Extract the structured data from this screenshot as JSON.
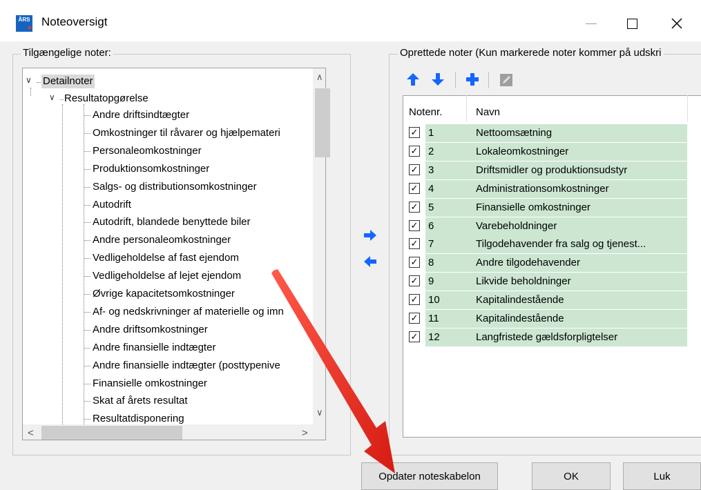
{
  "window": {
    "title": "Noteoversigt",
    "app_icon_text": "ÅRS"
  },
  "left_group": {
    "label": "Tilgængelige noter:",
    "root": "Detailnoter",
    "section": "Resultatopgørelse",
    "items": [
      "Andre driftsindtægter",
      "Omkostninger til råvarer og hjælpemateri",
      "Personaleomkostninger",
      "Produktionsomkostninger",
      "Salgs- og distributionsomkostninger",
      "Autodrift",
      "Autodrift, blandede benyttede biler",
      "Andre personaleomkostninger",
      "Vedligeholdelse af fast ejendom",
      "Vedligeholdelse af lejet ejendom",
      "Øvrige kapacitetsomkostninger",
      "Af- og nedskrivninger af materielle og imn",
      "Andre driftsomkostninger",
      "Andre finansielle indtægter",
      "Andre finansielle indtægter (posttypenive",
      "Finansielle omkostninger",
      "Skat af årets resultat",
      "Resultatdisponering"
    ]
  },
  "right_group": {
    "label": "Oprettede noter (Kun markerede noter kommer på udskri",
    "columns": {
      "num": "Notenr.",
      "name": "Navn"
    },
    "rows": [
      {
        "num": "1",
        "name": "Nettoomsætning",
        "checked": true
      },
      {
        "num": "2",
        "name": "Lokaleomkostninger",
        "checked": true
      },
      {
        "num": "3",
        "name": "Driftsmidler og produktionsudstyr",
        "checked": true
      },
      {
        "num": "4",
        "name": "Administrationsomkostninger",
        "checked": true
      },
      {
        "num": "5",
        "name": "Finansielle omkostninger",
        "checked": true
      },
      {
        "num": "6",
        "name": "Varebeholdninger",
        "checked": true
      },
      {
        "num": "7",
        "name": "Tilgodehavender fra salg og tjenest...",
        "checked": true
      },
      {
        "num": "8",
        "name": "Andre tilgodehavender",
        "checked": true
      },
      {
        "num": "9",
        "name": "Likvide beholdninger",
        "checked": true
      },
      {
        "num": "10",
        "name": "Kapitalindestående",
        "checked": true
      },
      {
        "num": "11",
        "name": "Kapitalindestående",
        "checked": true
      },
      {
        "num": "12",
        "name": "Langfristede gældsforpligtelser",
        "checked": true
      }
    ]
  },
  "toolbar": {
    "icons": [
      "arrow-up-icon",
      "arrow-down-icon",
      "plus-icon",
      "edit-icon"
    ]
  },
  "buttons": {
    "update": "Opdater noteskabelon",
    "ok": "OK",
    "close": "Luk"
  },
  "colors": {
    "row_highlight": "#cce6d2",
    "accent_blue": "#1565ff",
    "annotation_red": "#e8271f"
  }
}
